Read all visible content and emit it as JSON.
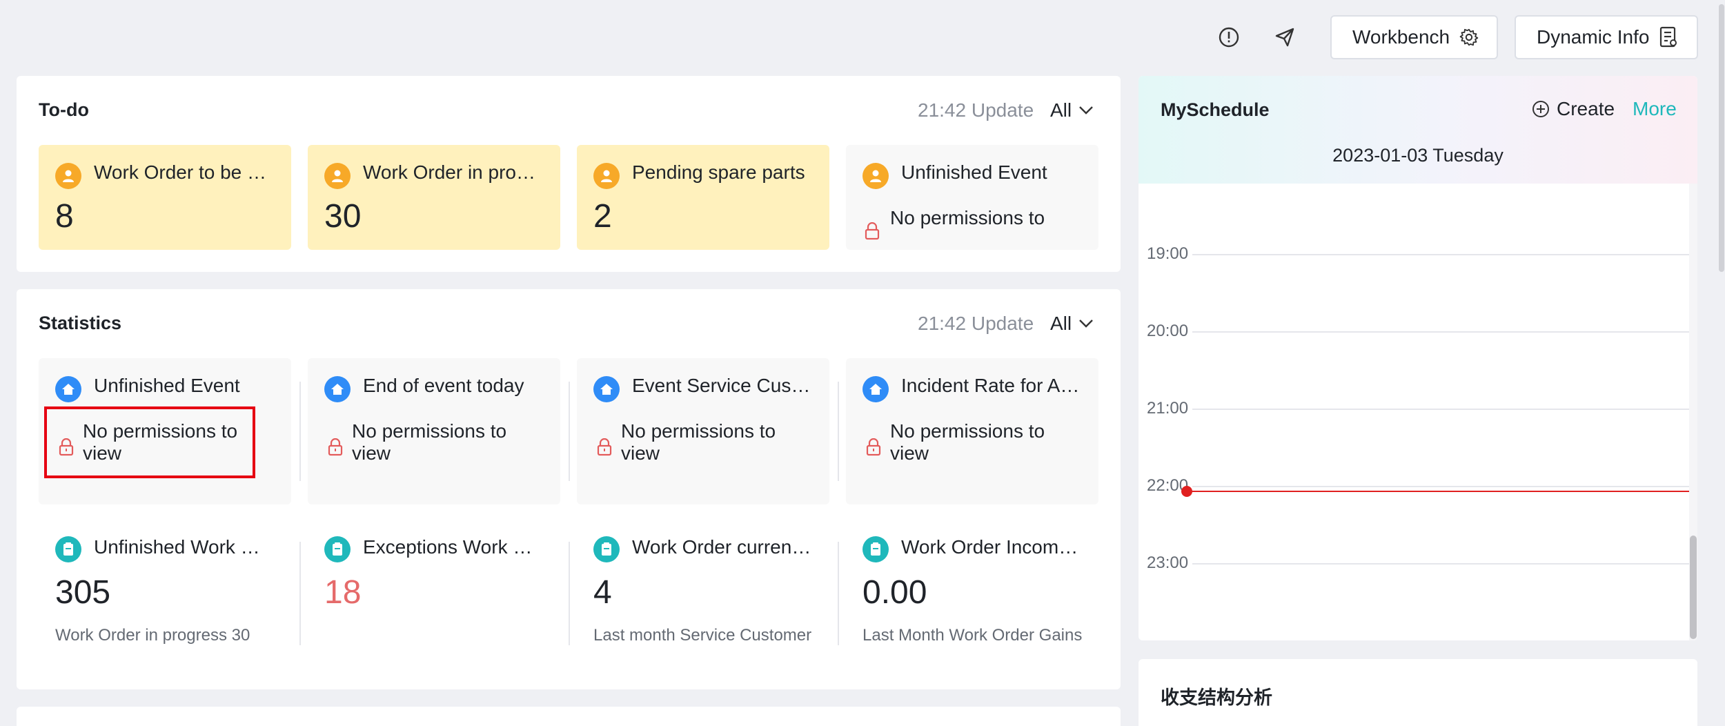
{
  "topbar": {
    "workbench_label": "Workbench",
    "dynamic_info_label": "Dynamic Info"
  },
  "todo": {
    "title": "To-do",
    "update_text": "21:42 Update",
    "filter": "All",
    "cards": [
      {
        "label": "Work Order to be …",
        "value": "8"
      },
      {
        "label": "Work Order in pro…",
        "value": "30"
      },
      {
        "label": "Pending spare parts",
        "value": "2"
      },
      {
        "label": "Unfinished Event",
        "no_permission": "No permissions to"
      }
    ]
  },
  "statistics": {
    "title": "Statistics",
    "update_text": "21:42 Update",
    "filter": "All",
    "event_cards": [
      {
        "label": "Unfinished Event",
        "line1": "No permissions to",
        "line2": "view"
      },
      {
        "label": "End of event today",
        "line1": "No permissions to",
        "line2": "view"
      },
      {
        "label": "Event Service Cus…",
        "line1": "No permissions to",
        "line2": "view"
      },
      {
        "label": "Incident Rate for A…",
        "line1": "No permissions to",
        "line2": "view"
      }
    ],
    "work_order_stats": [
      {
        "label": "Unfinished Work …",
        "value": "305",
        "sub": "Work Order in progress  30"
      },
      {
        "label": "Exceptions Work …",
        "value": "18",
        "sub": ""
      },
      {
        "label": "Work Order curren…",
        "value": "4",
        "sub": "Last month Service Customer"
      },
      {
        "label": "Work Order Incom…",
        "value": "0.00",
        "sub": "Last Month Work Order Gains"
      }
    ]
  },
  "schedule": {
    "title": "MySchedule",
    "create_label": "Create",
    "more_label": "More",
    "date": "2023-01-03 Tuesday",
    "hours": [
      "19:00",
      "20:00",
      "21:00",
      "22:00",
      "23:00"
    ]
  },
  "income_panel": {
    "title": "收支结构分析"
  },
  "colors": {
    "accent": "#1fb8bb",
    "todo_card": "#fff1bd",
    "orange_icon": "#f7a928",
    "blue_icon": "#2f8cf7",
    "exception_value": "#e56a6a",
    "lock": "#e35b5b",
    "highlight": "#e60012"
  }
}
